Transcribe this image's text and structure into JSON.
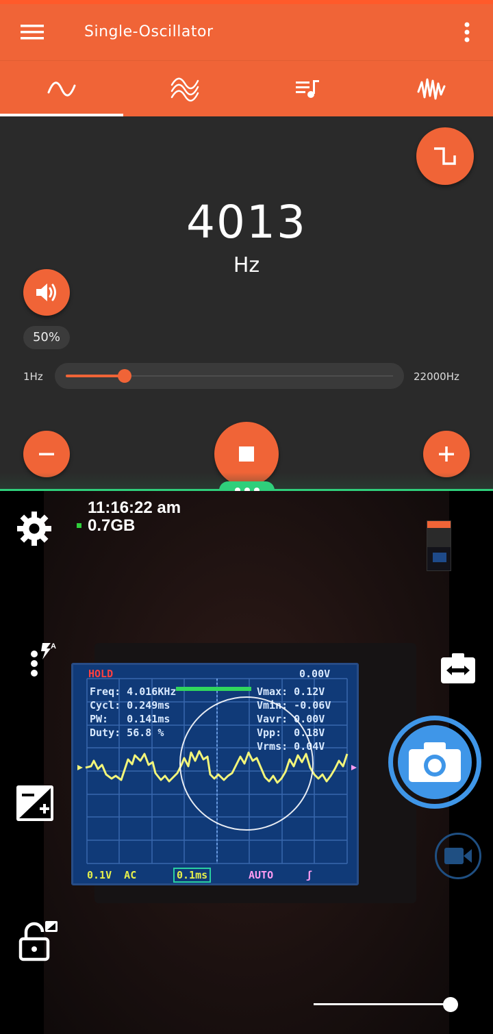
{
  "top_app": {
    "title": "Single-Oscillator",
    "tabs": [
      {
        "icon": "sine-wave-icon",
        "selected": true
      },
      {
        "icon": "multi-wave-icon",
        "selected": false
      },
      {
        "icon": "playlist-music-icon",
        "selected": false
      },
      {
        "icon": "noise-wave-icon",
        "selected": false
      }
    ],
    "waveform_button_icon": "square-wave-icon",
    "frequency": "4013",
    "frequency_unit": "Hz",
    "volume_label": "50%",
    "slider": {
      "min_label": "1Hz",
      "max_label": "22000Hz",
      "value_fraction": 0.18
    },
    "accent_color": "#f06437"
  },
  "camera": {
    "clock": "11:16:22 am",
    "memory": "0.7GB",
    "divider_color": "#2fcf7b",
    "shutter_color": "#3f96e8",
    "zoom_fraction": 1.0
  },
  "scope_screen": {
    "hold": "HOLD",
    "trigger_level": "0.00V",
    "freq": "Freq: 4.016KHz",
    "cycl": "Cycl: 0.249ms",
    "pw": "PW:   0.141ms",
    "duty": "Duty: 56.8 %",
    "vmax": "Vmax: 0.12V",
    "vmin": "Vmin: -0.06V",
    "vavr": "Vavr: 0.00V",
    "vpp": "Vpp:  0.18V",
    "vrms": "Vrms: 0.04V",
    "volt_div": "0.1V  AC",
    "time_div": "0.1ms",
    "mode": "AUTO",
    "slope": "ʃ"
  }
}
